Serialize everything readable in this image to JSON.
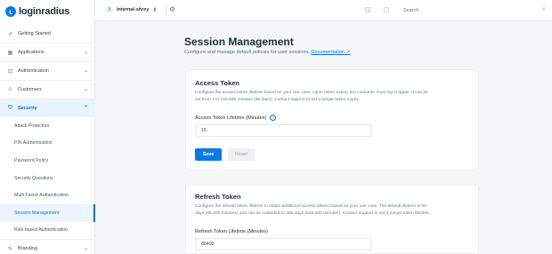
{
  "brand": {
    "name": "loginradius"
  },
  "topbar": {
    "app_name": "internal-shrey",
    "app_initial": "I",
    "search_placeholder": "Search"
  },
  "sidebar": {
    "items": [
      {
        "label": "Getting Started",
        "icon": "rocket-icon"
      },
      {
        "label": "Applications",
        "icon": "grid-icon",
        "expandable": true
      },
      {
        "label": "Authentication",
        "icon": "lock-icon",
        "expandable": true
      },
      {
        "label": "Customers",
        "icon": "users-icon",
        "expandable": true
      },
      {
        "label": "Security",
        "icon": "shield-icon",
        "expandable": true,
        "expanded": true
      }
    ],
    "security_sub": [
      "Attack Protection",
      "PIN Authentication",
      "Password Policy",
      "Security Questions",
      "Multi Factor Authentication",
      "Session Management",
      "Risk-based Authentication"
    ],
    "selected_sub": "Session Management",
    "bottom_item": {
      "label": "Branding",
      "icon": "brush-icon",
      "expandable": true
    }
  },
  "main": {
    "title": "Session Management",
    "subtitle": "Configure and manage default policies for user sessions.",
    "doc_link": "Documentation ↗"
  },
  "access_token": {
    "title": "Access Token",
    "desc_line1": "Configure the access token lifetime based on your use case. Upon token expiry, the customer must log in again. It can be",
    "desc_line2": "set from 1 to 129,600 minutes (90 days). Contact support to set a longer token expiry.",
    "field_label": "Access Token Lifetime (Minutes)",
    "value": "15",
    "save_label": "Save",
    "reset_label": "Reset"
  },
  "refresh_token": {
    "title": "Refresh Token",
    "desc_line1": "Configure the refresh token lifetime to obtain additional access tokens based on your use case. The default lifetime is 60",
    "desc_line2": "days (86,400 minutes) and can be extended to 365 days (525,600 minutes). Contact support to set a longer token lifetime.",
    "field_label": "Refresh Token Lifetime (Minutes)",
    "value": "86400"
  },
  "colors": {
    "accent": "#0a7ae6",
    "active_bg": "#eaf3fd"
  }
}
